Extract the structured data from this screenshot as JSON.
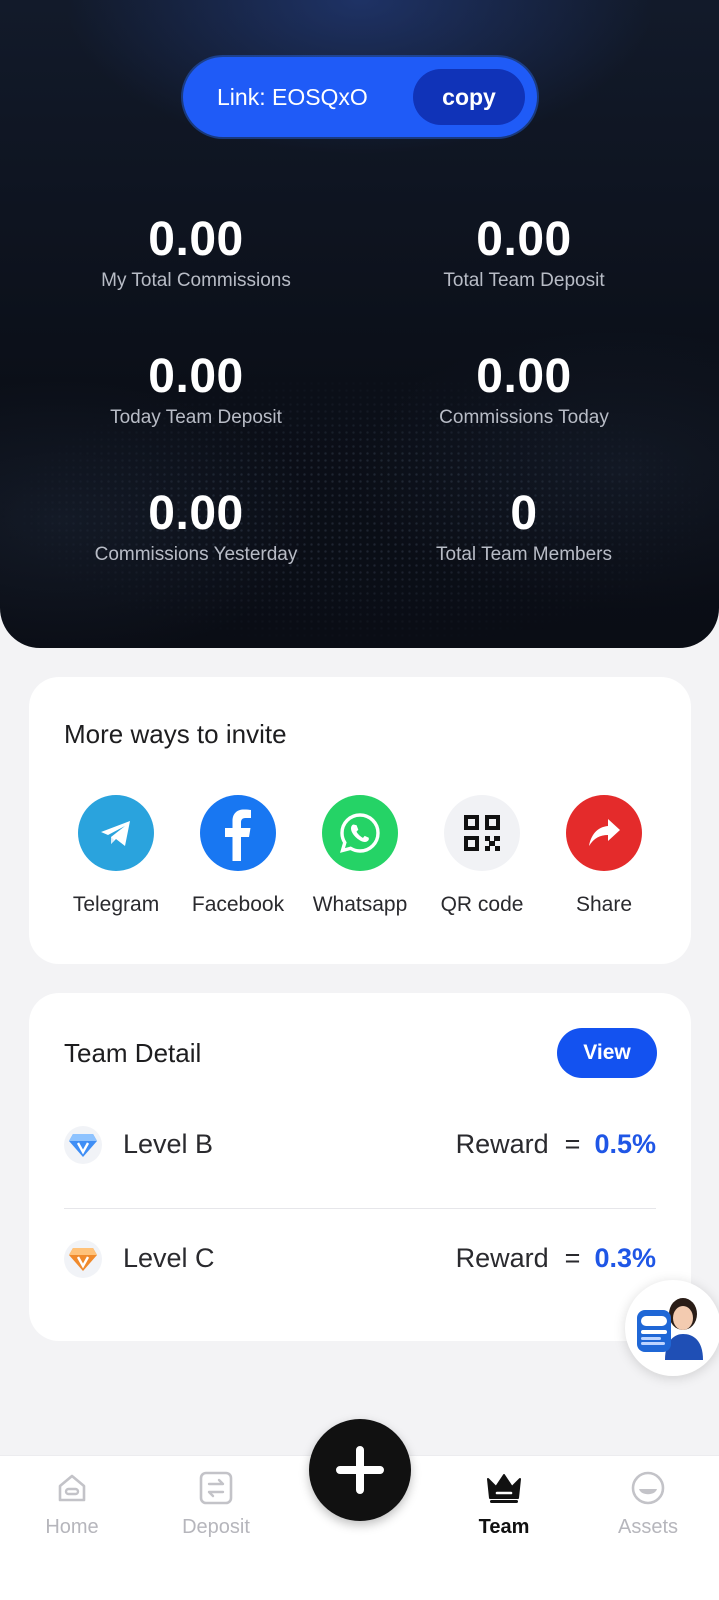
{
  "header": {
    "link_label": "Link: EOSQxO",
    "copy_label": "copy"
  },
  "stats": [
    {
      "value": "0.00",
      "label": "My Total Commissions"
    },
    {
      "value": "0.00",
      "label": "Total Team Deposit"
    },
    {
      "value": "0.00",
      "label": "Today Team Deposit"
    },
    {
      "value": "0.00",
      "label": "Commissions Today"
    },
    {
      "value": "0.00",
      "label": "Commissions Yesterday"
    },
    {
      "value": "0",
      "label": "Total Team Members"
    }
  ],
  "invite": {
    "title": "More ways to invite",
    "items": [
      {
        "label": "Telegram",
        "icon": "telegram-icon",
        "color": "#2aa3dd"
      },
      {
        "label": "Facebook",
        "icon": "facebook-icon",
        "color": "#1877f2"
      },
      {
        "label": "Whatsapp",
        "icon": "whatsapp-icon",
        "color": "#25d366"
      },
      {
        "label": "QR code",
        "icon": "qr-code-icon",
        "color": "#f1f2f5"
      },
      {
        "label": "Share",
        "icon": "share-icon",
        "color": "#e42b2b"
      }
    ]
  },
  "team": {
    "title": "Team Detail",
    "view_label": "View",
    "levels": [
      {
        "name": "Level B",
        "reward_label": "Reward",
        "equals": "=",
        "reward": "0.5%",
        "badge_color": "#3f8ef5"
      },
      {
        "name": "Level C",
        "reward_label": "Reward",
        "equals": "=",
        "reward": "0.3%",
        "badge_color": "#f08a2c"
      }
    ]
  },
  "nav": {
    "items": [
      {
        "label": "Home",
        "icon": "home-icon"
      },
      {
        "label": "Deposit",
        "icon": "deposit-icon"
      },
      {
        "label": "Team",
        "icon": "crown-icon"
      },
      {
        "label": "Assets",
        "icon": "assets-icon"
      }
    ],
    "active": "Team",
    "center_icon": "plus-icon"
  },
  "colors": {
    "accent": "#1f5bf7",
    "reward": "#1f56e6",
    "hero_bg": "#0b0f18"
  }
}
